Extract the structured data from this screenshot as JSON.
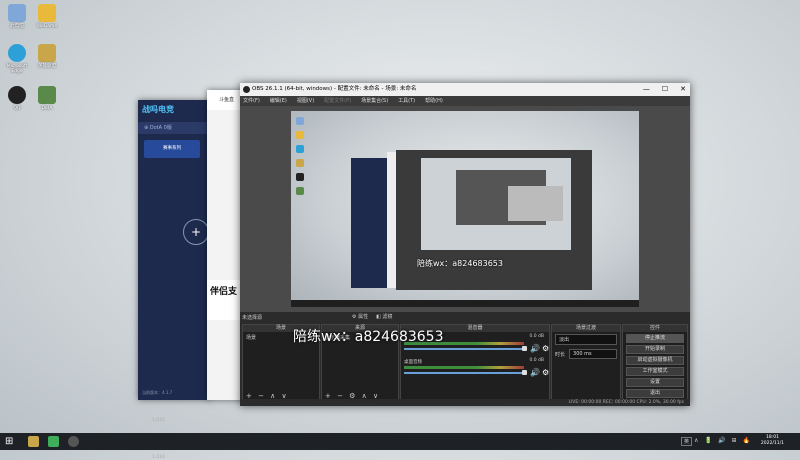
{
  "desktop": {
    "icons": [
      {
        "label": "此电脑",
        "icon": "computer-icon",
        "color": "#7fa8d8"
      },
      {
        "label": "WeGame",
        "icon": "game-icon",
        "color": "#e8b93a"
      },
      {
        "label": "Microsoft Edge",
        "icon": "edge-icon",
        "color": "#2ea0d8"
      },
      {
        "label": "英雄联盟",
        "icon": "sword-icon",
        "color": "#c9a64a"
      },
      {
        "label": "QQ",
        "icon": "penguin-icon",
        "color": "#222222"
      },
      {
        "label": "DotA",
        "icon": "shield-icon",
        "color": "#5a8a4a"
      }
    ]
  },
  "bg_window_a": {
    "logo": "战吗电竞",
    "tab": "⊕ DotA 0版",
    "banner": "赛事系列",
    "plus": "+",
    "y_top": "1,010",
    "y_bottom": "1,010",
    "footer": "当前版本：4.1.7"
  },
  "bg_window_b": {
    "head": "斗鱼直",
    "promo": "伴侣支"
  },
  "obs": {
    "title": "OBS 26.1.1 (64-bit, windows) - 配置文件: 未命名 - 场景: 未命名",
    "menu": [
      "文件(F)",
      "编辑(E)",
      "视图(V)",
      "配置文件(P)",
      "场景集合(S)",
      "工具(T)",
      "帮助(H)"
    ],
    "menu_disabled_index": 3,
    "window_controls": [
      "—",
      "☐",
      "✕"
    ],
    "preview_watermark": "陪练wx：a824683653",
    "scene_bar": {
      "label": "未选择源",
      "buttons": [
        "⚙ 属性",
        "◧ 滤镜"
      ]
    },
    "docks": {
      "scenes": {
        "title": "场景",
        "items": [
          "场景"
        ],
        "footer": "+ − ∧ ∨"
      },
      "sources": {
        "title": "来源",
        "items": [
          "显示器采集"
        ],
        "footer": "+ − ⚙ ∧ ∨"
      },
      "mixer": {
        "title": "混音器",
        "tracks": [
          {
            "name": "",
            "db": "0.0 dB"
          },
          {
            "name": "桌面音频",
            "db": "0.0 dB"
          }
        ]
      },
      "transitions": {
        "title": "场景过渡",
        "type": "淡出",
        "duration_label": "时长",
        "duration": "300 ms"
      },
      "controls": {
        "title": "控件",
        "buttons": [
          "停止推流",
          "开始录制",
          "启动虚拟摄像机",
          "工作室模式",
          "设置",
          "退出"
        ]
      }
    },
    "status": "LIVE: 00:00:00   REC: 00:00:00   CPU: 2.0%, 30.00 fps"
  },
  "big_watermark": "陪练wx：a824683653",
  "taskbar": {
    "start": "⊞",
    "apps": [
      {
        "icon": "game-app-icon",
        "color": "#c9a64a"
      },
      {
        "icon": "green-app-icon",
        "color": "#3fae5a"
      },
      {
        "icon": "obs-app-icon",
        "color": "#555555"
      }
    ],
    "lang": "英",
    "tray": [
      "∧",
      "🔋",
      "🔊",
      "⊞",
      "🔥"
    ],
    "time": "18:01",
    "date": "2022/11/1"
  }
}
